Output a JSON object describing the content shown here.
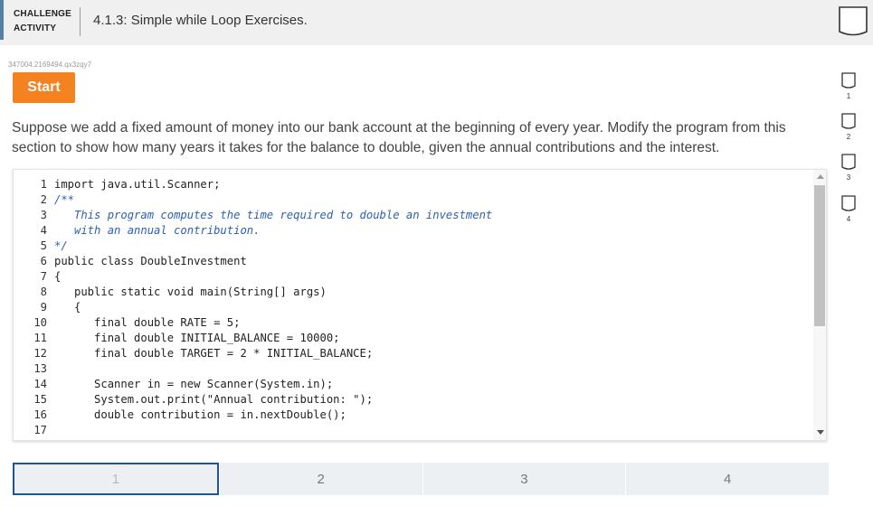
{
  "header": {
    "badge_line1": "CHALLENGE",
    "badge_line2": "ACTIVITY",
    "title": "4.1.3: Simple while Loop Exercises."
  },
  "activity_id": "347004.2169494.qx3zqy7",
  "start_label": "Start",
  "prompt": "Suppose we add a fixed amount of money into our bank account at the beginning of every year. Modify the program from this section to show how many years it takes for the balance to double, given the annual contributions and the interest.",
  "code": {
    "lines": [
      {
        "num": "1",
        "text": "import java.util.Scanner;",
        "style": "kw"
      },
      {
        "num": "2",
        "text": "/**",
        "style": "cm"
      },
      {
        "num": "3",
        "text": "   This program computes the time required to double an investment",
        "style": "cm"
      },
      {
        "num": "4",
        "text": "   with an annual contribution.",
        "style": "cm"
      },
      {
        "num": "5",
        "text": "*/",
        "style": "cm"
      },
      {
        "num": "6",
        "text": "public class DoubleInvestment",
        "style": "kw"
      },
      {
        "num": "7",
        "text": "{",
        "style": "kw"
      },
      {
        "num": "8",
        "text": "   public static void main(String[] args)",
        "style": "kw"
      },
      {
        "num": "9",
        "text": "   {",
        "style": "kw"
      },
      {
        "num": "10",
        "text": "      final double RATE = 5;",
        "style": "kw"
      },
      {
        "num": "11",
        "text": "      final double INITIAL_BALANCE = 10000;",
        "style": "kw"
      },
      {
        "num": "12",
        "text": "      final double TARGET = 2 * INITIAL_BALANCE;",
        "style": "kw"
      },
      {
        "num": "13",
        "text": "",
        "style": "kw"
      },
      {
        "num": "14",
        "text": "      Scanner in = new Scanner(System.in);",
        "style": "call"
      },
      {
        "num": "15",
        "text": "      System.out.print(\"Annual contribution: \");",
        "style": "call"
      },
      {
        "num": "16",
        "text": "      double contribution = in.nextDouble();",
        "style": "call"
      },
      {
        "num": "17",
        "text": "",
        "style": "kw"
      }
    ]
  },
  "steps": [
    "1",
    "2",
    "3",
    "4"
  ],
  "active_step": "1",
  "side_levels": [
    "1",
    "2",
    "3",
    "4"
  ],
  "colors": {
    "accent_orange": "#f58220",
    "active_step_border": "#215493",
    "badge_bar": "#5780a8",
    "comment": "#2b5fb8"
  },
  "icons": {
    "header": "shield-icon",
    "level": "level-shield-icon"
  }
}
